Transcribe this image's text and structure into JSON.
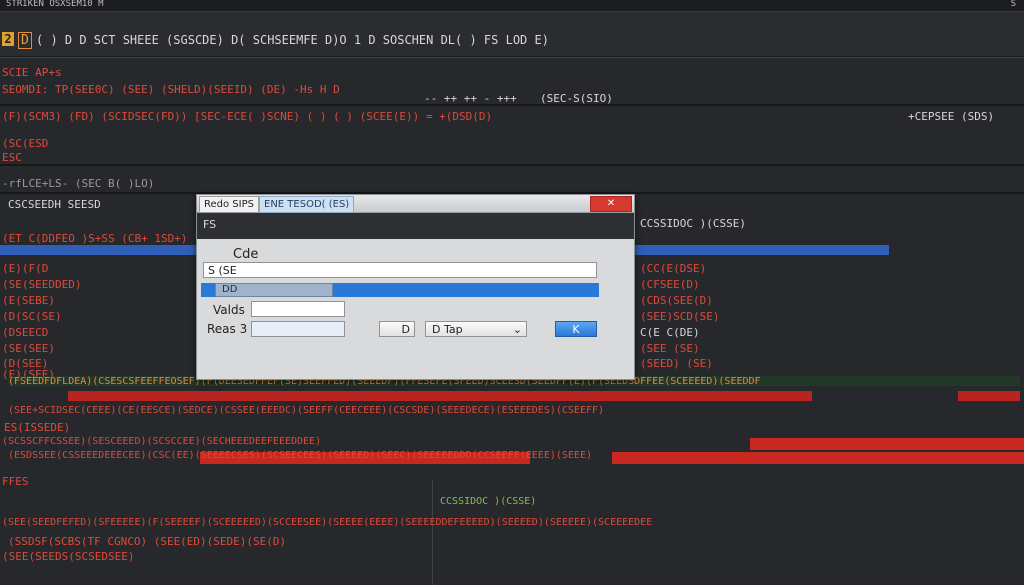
{
  "window": {
    "title": "STRIKEN  OSXSEM10  M",
    "corner": "S"
  },
  "toolbar": {
    "left_badge": "2",
    "left_label": "D",
    "line1": "( ) D  D SCT SHEEE (SGSCDE)  D( SCHSEEMFE  D)O 1 D SOSCHEN  DL( ) FS LOD E)",
    "right_a": "-- ++ ++ - +++",
    "right_b": "(SEC-S(SIO)"
  },
  "code": {
    "l1": "SCIE AP+s",
    "l2": "SEOMDI:  TP(SEE0C)  (SEE) (SHELD)(SEEID)   (DE)  -Hs H    D",
    "l3": "-rfLCE+LS-  (SEC B( )LO)",
    "l4": "(F)(SCM3)  (FD)  (SCIDSEC(FD))  [SEC-ECE(  )SCNE)  ( ) ( ) (SCEE(E)) =  +(DSD(D)",
    "l5": "+CEPSEE (SDS)",
    "l6": "(SC(ESD",
    "l7": "ESC",
    "l8": "CSCSEEDH SEESD",
    "l9": "(ET C(DDFEO  )S+SS (CB+ 1SD+)",
    "l10": "(E)(F(D",
    "l11": "(SE(SEEDDED)",
    "l12": "(E(SEBE)",
    "l13": "(D(SC(SE)",
    "l14": "(DSEECD",
    "l15": "(SE(SEE)",
    "l16": "(D(SEE)",
    "l17": "(E)(SEE)",
    "l18": "(FSEEDFDFLDEA)(CSESCSFEEFFEOSEF)(F(DEESEDFFEF(SE)SEEFFED)(SEEEDF)(FFESEFE(SFEED)SCEESD(SEEDFF(E)(F(SEEDSDFFEE(SCEEEED)(SEEDDF",
    "l19": "(SEE+SCIDSEC(CEEE)(CE(EESCE)(SEDCE)(CSSEE(EEEDC)(SEEFF(CEECEEE)(CSCSDE)(SEEEDECE)(ESEEEDES)(CSEEFF)",
    "l20": "ES(ISSEDE)",
    "l21": "(SCSSCFFCSSEE)(SESCEEED)(SCSCCEE)(SECHEEEDEEFEEEDDEE)",
    "l22": "(ESDSSEE(CSSEEEDEEECEE)(CSC(EE)(SEEEECSES)(SCSEECEES)(SEEEED)(SEEC)(SEEEEEDDD(CCSEEFF(EEEE)(SEEE)",
    "l23": "FFES",
    "l24": "(SEE(SEEDFEFED)(SFEEEEE)(F(SEEEEF)(SCEEEEED)(SCCEESEE)(SEEEE(EEEE)(SEEEEDDEFEEEED)(SEEEED)(SEEEEE)(SCEEEEDEE",
    "l25": "(SSDSF(SCBS(TF CGNCO)  (SEE(ED)(SEDE)(SE(D)",
    "l26": "(SEE(SEEDS(SCSEDSEE)",
    "r1": "CCSSIDOC )(CSSE)",
    "r2": "(CC(E(DSE)",
    "r3": "(CFSEE(D)",
    "r4": "(CDS(SEE(D)",
    "r5": "(SEE)SCD(SE)",
    "r6": "C(E  C(DE)",
    "r7": "(SEE (SE)",
    "r8": "(SEED) (SE)"
  },
  "dialog": {
    "tab1": "Redo SIPS",
    "tab2": "ENE TESOD(  (ES)",
    "close_label": "",
    "header": "FS",
    "section_label": "Cde",
    "input_value": "S  (SE",
    "combo_value": "DD",
    "label_values": "Valds",
    "label_reas": "Reas 3",
    "values_input": "",
    "reas_input": "",
    "small_btn": "D",
    "dropdown_value": "D Tap",
    "ok_label": "K"
  }
}
